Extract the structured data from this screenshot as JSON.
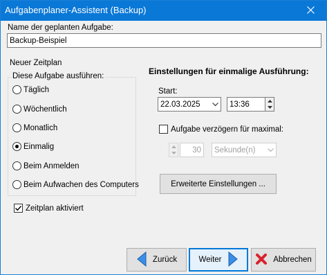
{
  "window": {
    "title": "Aufgabenplaner-Assistent (Backup)",
    "close_glyph": "✕"
  },
  "task_name": {
    "label": "Name der geplanten Aufgabe:",
    "value": "Backup-Beispiel"
  },
  "schedule": {
    "header": "Neuer Zeitplan",
    "group_label": "Diese Aufgabe ausführen:",
    "options": [
      {
        "label": "Täglich",
        "checked": false
      },
      {
        "label": "Wöchentlich",
        "checked": false
      },
      {
        "label": "Monatlich",
        "checked": false
      },
      {
        "label": "Einmalig",
        "checked": true
      },
      {
        "label": "Beim Anmelden",
        "checked": false
      },
      {
        "label": "Beim Aufwachen des Computers",
        "checked": false
      }
    ],
    "enabled_label": "Zeitplan aktiviert",
    "enabled_checked": true
  },
  "once": {
    "header": "Einstellungen für einmalige Ausführung:",
    "start_label": "Start:",
    "date": "22.03.2025",
    "time": "13:36",
    "delay_label": "Aufgabe verzögern für maximal:",
    "delay_checked": false,
    "delay_value": "30",
    "delay_unit": "Sekunde(n)",
    "advanced_button": "Erweiterte Einstellungen ..."
  },
  "footer": {
    "back": "Zurück",
    "next": "Weiter",
    "cancel": "Abbrechen"
  },
  "colors": {
    "titlebar": "#0a78d7",
    "accent": "#0078d7",
    "arrow_blue": "#3a8ee6",
    "cancel_red": "#d9232e"
  }
}
